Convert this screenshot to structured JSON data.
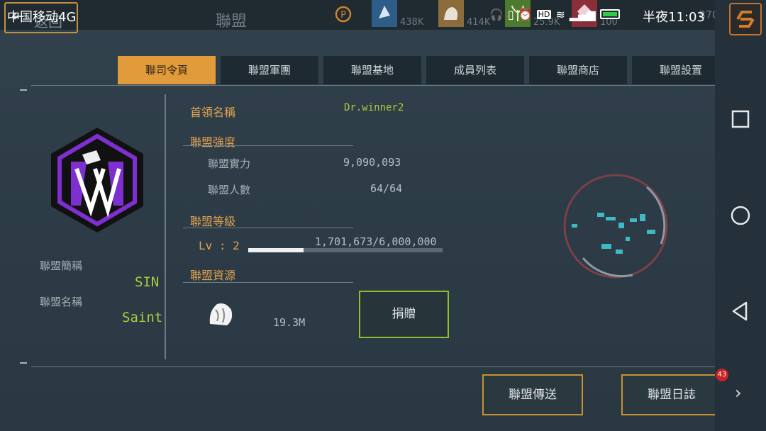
{
  "status_bar": {
    "carrier": "中国移动4G",
    "time": "半夜11:03"
  },
  "header": {
    "back_label": "返回",
    "title": "聯盟",
    "resources": [
      {
        "icon": "crystal-icon",
        "value": "438K",
        "color": "#2f5d8a"
      },
      {
        "icon": "stone-icon",
        "value": "414K",
        "color": "#8a6d3a"
      },
      {
        "icon": "plant-icon",
        "value": "25.9K",
        "color": "#4d7a2e"
      },
      {
        "icon": "gem-icon",
        "value": "100",
        "color": "#8a2f3a"
      }
    ],
    "hidden_value": "870"
  },
  "tabs": [
    {
      "label": "聯司令頁",
      "active": true
    },
    {
      "label": "聯盟軍團",
      "active": false
    },
    {
      "label": "聯盟基地",
      "active": false
    },
    {
      "label": "成員列表",
      "active": false
    },
    {
      "label": "聯盟商店",
      "active": false
    },
    {
      "label": "聯盟設置",
      "active": false
    }
  ],
  "alliance": {
    "short_name_label": "聯盟簡稱",
    "short_name": "SIN",
    "full_name_label": "聯盟名稱",
    "full_name": "Saint"
  },
  "info": {
    "leader_label": "首領名稱",
    "leader": "Dr.winner2",
    "strength_header": "聯盟強度",
    "power_label": "聯盟實力",
    "power": "9,090,093",
    "members_label": "聯盟人數",
    "members": "64/64",
    "level_header": "聯盟等級",
    "level": "Lv : 2",
    "exp": "1,701,673/6,000,000",
    "exp_fraction": 0.284,
    "resource_header": "聯盟資源",
    "resource_value": "19.3M",
    "donate_label": "捐贈"
  },
  "footer": {
    "teleport_label": "聯盟傳送",
    "log_label": "聯盟日誌",
    "log_badge": "43"
  },
  "colors": {
    "accent": "#e29b3a",
    "green": "#a8cf3d",
    "emblem_purple": "#7d2fd0"
  }
}
